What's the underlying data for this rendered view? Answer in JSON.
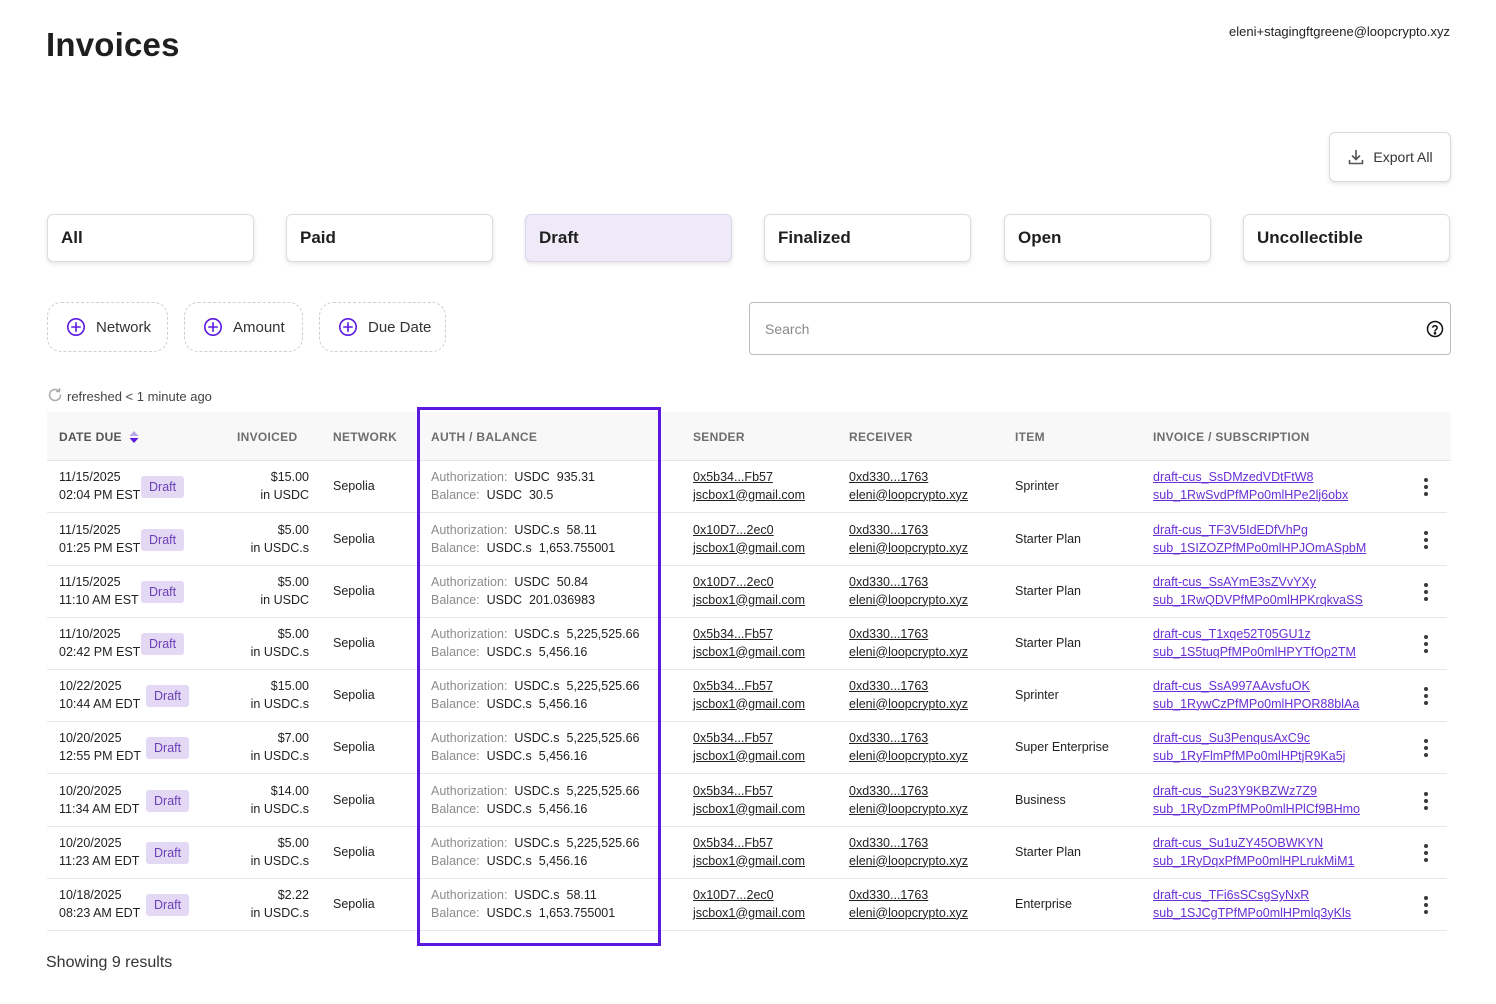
{
  "page": {
    "title": "Invoices",
    "user_email": "eleni+stagingftgreene@loopcrypto.xyz"
  },
  "export": {
    "label": "Export All",
    "icon": "download-icon"
  },
  "status_tabs": [
    {
      "label": "All",
      "active": false
    },
    {
      "label": "Paid",
      "active": false
    },
    {
      "label": "Draft",
      "active": true
    },
    {
      "label": "Finalized",
      "active": false
    },
    {
      "label": "Open",
      "active": false
    },
    {
      "label": "Uncollectible",
      "active": false
    }
  ],
  "filters": [
    {
      "label": "Network",
      "icon": "plus-circle-icon"
    },
    {
      "label": "Amount",
      "icon": "plus-circle-icon"
    },
    {
      "label": "Due Date",
      "icon": "plus-circle-icon"
    }
  ],
  "search": {
    "placeholder": "Search",
    "help_icon": "question-circle-icon"
  },
  "refresh": {
    "text": "refreshed < 1 minute ago",
    "icon": "refresh-icon"
  },
  "table": {
    "columns": [
      "DATE DUE",
      "INVOICED",
      "NETWORK",
      "AUTH / BALANCE",
      "SENDER",
      "RECEIVER",
      "ITEM",
      "INVOICE / SUBSCRIPTION"
    ],
    "sort_icon": "sort-arrows-icon",
    "auth_label": "Authorization:",
    "balance_label": "Balance:",
    "rows": [
      {
        "date": "11/15/2025",
        "time": "02:04 PM EST",
        "status": "Draft",
        "amount": "$15.00",
        "currency": "in USDC",
        "network": "Sepolia",
        "auth_token": "USDC",
        "auth_value": "935.31",
        "bal_token": "USDC",
        "bal_value": "30.5",
        "sender_addr": "0x5b34...Fb57",
        "sender_email": "jscbox1@gmail.com",
        "receiver_addr": "0xd330...1763",
        "receiver_email": "eleni@loopcrypto.xyz",
        "item": "Sprinter",
        "invoice_id": "draft-cus_SsDMzedVDtFtW8",
        "sub_id": "sub_1RwSvdPfMPo0mlHPe2lj6obx"
      },
      {
        "date": "11/15/2025",
        "time": "01:25 PM EST",
        "status": "Draft",
        "amount": "$5.00",
        "currency": "in USDC.s",
        "network": "Sepolia",
        "auth_token": "USDC.s",
        "auth_value": "58.11",
        "bal_token": "USDC.s",
        "bal_value": "1,653.755001",
        "sender_addr": "0x10D7...2ec0",
        "sender_email": "jscbox1@gmail.com",
        "receiver_addr": "0xd330...1763",
        "receiver_email": "eleni@loopcrypto.xyz",
        "item": "Starter Plan",
        "invoice_id": "draft-cus_TF3V5IdEDfVhPg",
        "sub_id": "sub_1SIZOZPfMPo0mlHPJOmASpbM"
      },
      {
        "date": "11/15/2025",
        "time": "11:10 AM EST",
        "status": "Draft",
        "amount": "$5.00",
        "currency": "in USDC",
        "network": "Sepolia",
        "auth_token": "USDC",
        "auth_value": "50.84",
        "bal_token": "USDC",
        "bal_value": "201.036983",
        "sender_addr": "0x10D7...2ec0",
        "sender_email": "jscbox1@gmail.com",
        "receiver_addr": "0xd330...1763",
        "receiver_email": "eleni@loopcrypto.xyz",
        "item": "Starter Plan",
        "invoice_id": "draft-cus_SsAYmE3sZVvYXy",
        "sub_id": "sub_1RwQDVPfMPo0mlHPKrqkvaSS"
      },
      {
        "date": "11/10/2025",
        "time": "02:42 PM EST",
        "status": "Draft",
        "amount": "$5.00",
        "currency": "in USDC.s",
        "network": "Sepolia",
        "auth_token": "USDC.s",
        "auth_value": "5,225,525.66",
        "bal_token": "USDC.s",
        "bal_value": "5,456.16",
        "sender_addr": "0x5b34...Fb57",
        "sender_email": "jscbox1@gmail.com",
        "receiver_addr": "0xd330...1763",
        "receiver_email": "eleni@loopcrypto.xyz",
        "item": "Starter Plan",
        "invoice_id": "draft-cus_T1xqe52T05GU1z",
        "sub_id": "sub_1S5tuqPfMPo0mlHPYTfOp2TM"
      },
      {
        "date": "10/22/2025",
        "time": "10:44 AM EDT",
        "status": "Draft",
        "amount": "$15.00",
        "currency": "in USDC.s",
        "network": "Sepolia",
        "auth_token": "USDC.s",
        "auth_value": "5,225,525.66",
        "bal_token": "USDC.s",
        "bal_value": "5,456.16",
        "sender_addr": "0x5b34...Fb57",
        "sender_email": "jscbox1@gmail.com",
        "receiver_addr": "0xd330...1763",
        "receiver_email": "eleni@loopcrypto.xyz",
        "item": "Sprinter",
        "invoice_id": "draft-cus_SsA997AAvsfuOK",
        "sub_id": "sub_1RywCzPfMPo0mlHPOR88blAa"
      },
      {
        "date": "10/20/2025",
        "time": "12:55 PM EDT",
        "status": "Draft",
        "amount": "$7.00",
        "currency": "in USDC.s",
        "network": "Sepolia",
        "auth_token": "USDC.s",
        "auth_value": "5,225,525.66",
        "bal_token": "USDC.s",
        "bal_value": "5,456.16",
        "sender_addr": "0x5b34...Fb57",
        "sender_email": "jscbox1@gmail.com",
        "receiver_addr": "0xd330...1763",
        "receiver_email": "eleni@loopcrypto.xyz",
        "item": "Super Enterprise",
        "invoice_id": "draft-cus_Su3PenqusAxC9c",
        "sub_id": "sub_1RyFlmPfMPo0mlHPtjR9Ka5j"
      },
      {
        "date": "10/20/2025",
        "time": "11:34 AM EDT",
        "status": "Draft",
        "amount": "$14.00",
        "currency": "in USDC.s",
        "network": "Sepolia",
        "auth_token": "USDC.s",
        "auth_value": "5,225,525.66",
        "bal_token": "USDC.s",
        "bal_value": "5,456.16",
        "sender_addr": "0x5b34...Fb57",
        "sender_email": "jscbox1@gmail.com",
        "receiver_addr": "0xd330...1763",
        "receiver_email": "eleni@loopcrypto.xyz",
        "item": "Business",
        "invoice_id": "draft-cus_Su23Y9KBZWz7Z9",
        "sub_id": "sub_1RyDzmPfMPo0mlHPlCf9BHmo"
      },
      {
        "date": "10/20/2025",
        "time": "11:23 AM EDT",
        "status": "Draft",
        "amount": "$5.00",
        "currency": "in USDC.s",
        "network": "Sepolia",
        "auth_token": "USDC.s",
        "auth_value": "5,225,525.66",
        "bal_token": "USDC.s",
        "bal_value": "5,456.16",
        "sender_addr": "0x5b34...Fb57",
        "sender_email": "jscbox1@gmail.com",
        "receiver_addr": "0xd330...1763",
        "receiver_email": "eleni@loopcrypto.xyz",
        "item": "Starter Plan",
        "invoice_id": "draft-cus_Su1uZY45OBWKYN",
        "sub_id": "sub_1RyDqxPfMPo0mlHPLrukMiM1"
      },
      {
        "date": "10/18/2025",
        "time": "08:23 AM EDT",
        "status": "Draft",
        "amount": "$2.22",
        "currency": "in USDC.s",
        "network": "Sepolia",
        "auth_token": "USDC.s",
        "auth_value": "58.11",
        "bal_token": "USDC.s",
        "bal_value": "1,653.755001",
        "sender_addr": "0x10D7...2ec0",
        "sender_email": "jscbox1@gmail.com",
        "receiver_addr": "0xd330...1763",
        "receiver_email": "eleni@loopcrypto.xyz",
        "item": "Enterprise",
        "invoice_id": "draft-cus_TFi6sSCsgSyNxR",
        "sub_id": "sub_1SJCgTPfMPo0mlHPmlq3yKls"
      }
    ]
  },
  "footer": {
    "results": "Showing 9 results"
  },
  "colors": {
    "accent": "#5b18e0",
    "badge_bg": "#e4d9f5",
    "badge_text": "#6a3fb5",
    "link": "#6a2fd6",
    "active_tab_bg": "#efeaf8"
  }
}
